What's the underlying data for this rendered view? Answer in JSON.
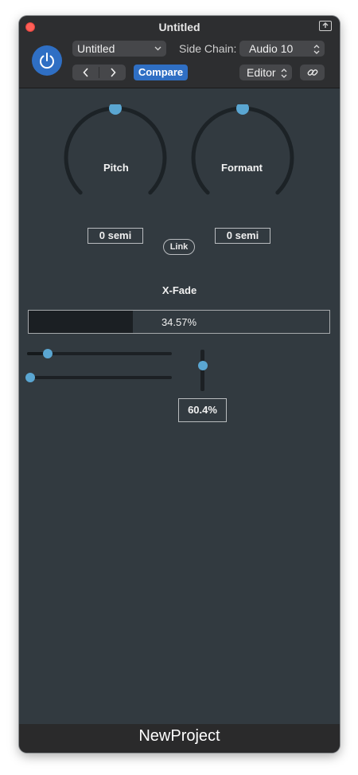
{
  "window": {
    "title": "Untitled",
    "footer": "NewProject"
  },
  "header": {
    "preset_value": "Untitled",
    "side_chain_label": "Side Chain:",
    "side_chain_value": "Audio 10",
    "compare_label": "Compare",
    "view_value": "Editor"
  },
  "knobs": {
    "pitch": {
      "label": "Pitch",
      "value_text": "0 semi",
      "level": 0.5
    },
    "formant": {
      "label": "Formant",
      "value_text": "0 semi",
      "level": 0.5
    }
  },
  "link_label": "Link",
  "xfade": {
    "label": "X-Fade",
    "value_text": "34.57%",
    "level": 0.3457
  },
  "sliders": {
    "h1_level": 0.12,
    "h2_level": 0.0,
    "v_level": 0.62,
    "v_value_text": "60.4%"
  },
  "colors": {
    "accent": "#2f6fc4",
    "thumb": "#5aa6d2",
    "panel": "#323a40",
    "titlebar": "#2d2e30"
  }
}
